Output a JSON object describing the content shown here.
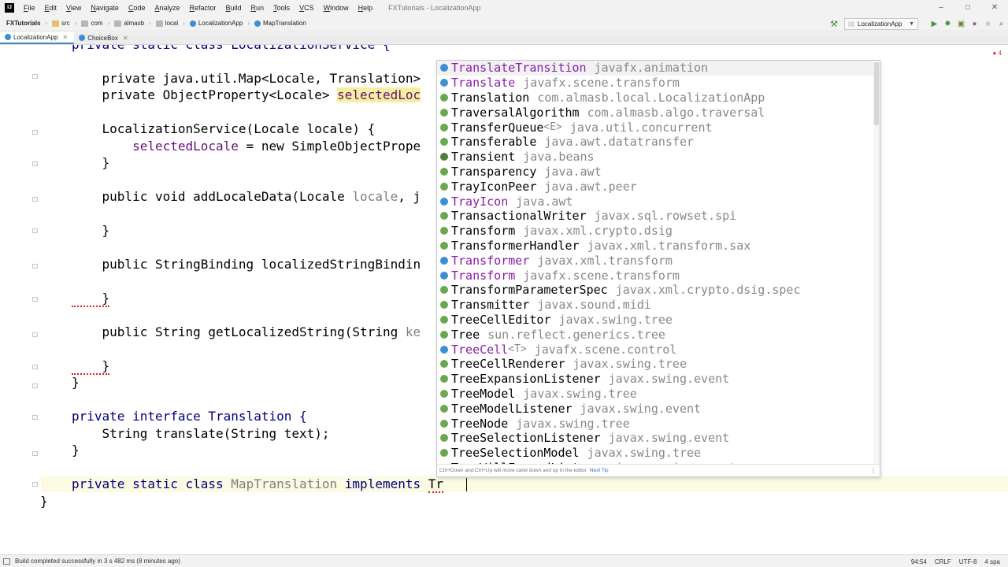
{
  "app": {
    "window_title": "FXTutorials - LocalizationApp",
    "menu": [
      "File",
      "Edit",
      "View",
      "Navigate",
      "Code",
      "Analyze",
      "Refactor",
      "Build",
      "Run",
      "Tools",
      "VCS",
      "Window",
      "Help"
    ]
  },
  "navbar": {
    "crumbs": [
      "FXTutorials",
      "src",
      "com",
      "almasb",
      "local",
      "LocalizationApp",
      "MapTranslation"
    ],
    "run_config": "LocalizationApp"
  },
  "tabs": [
    {
      "label": "LocalizationApp",
      "active": true
    },
    {
      "label": "ChoiceBox",
      "active": false
    }
  ],
  "editor": {
    "error_count": "4",
    "lines": {
      "l1": "private static class LocalizationService {",
      "l2a": "    private java.util.Map<Locale, Translation>",
      "l3a": "    private ObjectProperty<Locale> ",
      "l3b": "selectedLoc",
      "l4": "    LocalizationService(Locale locale) {",
      "l5a": "        ",
      "l5b": "selectedLocale",
      "l5c": " = new SimpleObjectPrope",
      "l6": "    }",
      "l7a": "    public void addLocaleData(Locale ",
      "l7b": "locale",
      "l7c": ", j",
      "l8": "    }",
      "l9": "    public StringBinding localizedStringBindin",
      "l10": "    }",
      "l11a": "    public String getLocalizedString(String ",
      "l11b": "ke",
      "l12": "    }",
      "l13": "}",
      "l14": "private interface Translation {",
      "l15": "    String translate(String text);",
      "l16": "}",
      "l17a": "private static class ",
      "l17b": "MapTranslation",
      "l17c": " implements ",
      "l17d": "Tr",
      "l18": "}"
    }
  },
  "completion": {
    "items": [
      {
        "name": "TranslateTransition",
        "generic": "",
        "pkg": "javafx.animation",
        "kind": "cls",
        "style": "purple"
      },
      {
        "name": "Translate",
        "generic": "",
        "pkg": "javafx.scene.transform",
        "kind": "cls",
        "style": "purple"
      },
      {
        "name": "Translation",
        "generic": "",
        "pkg": "com.almasb.local.LocalizationApp",
        "kind": "iface",
        "style": "plain"
      },
      {
        "name": "TraversalAlgorithm",
        "generic": "",
        "pkg": "com.almasb.algo.traversal",
        "kind": "iface",
        "style": "plain"
      },
      {
        "name": "TransferQueue",
        "generic": "<E>",
        "pkg": "java.util.concurrent",
        "kind": "iface",
        "style": "plain"
      },
      {
        "name": "Transferable",
        "generic": "",
        "pkg": "java.awt.datatransfer",
        "kind": "iface",
        "style": "plain"
      },
      {
        "name": "Transient",
        "generic": "",
        "pkg": "java.beans",
        "kind": "enm",
        "style": "plain"
      },
      {
        "name": "Transparency",
        "generic": "",
        "pkg": "java.awt",
        "kind": "iface",
        "style": "plain"
      },
      {
        "name": "TrayIconPeer",
        "generic": "",
        "pkg": "java.awt.peer",
        "kind": "iface",
        "style": "plain"
      },
      {
        "name": "TrayIcon",
        "generic": "",
        "pkg": "java.awt",
        "kind": "cls",
        "style": "purple"
      },
      {
        "name": "TransactionalWriter",
        "generic": "",
        "pkg": "javax.sql.rowset.spi",
        "kind": "iface",
        "style": "plain"
      },
      {
        "name": "Transform",
        "generic": "",
        "pkg": "javax.xml.crypto.dsig",
        "kind": "iface",
        "style": "plain"
      },
      {
        "name": "TransformerHandler",
        "generic": "",
        "pkg": "javax.xml.transform.sax",
        "kind": "iface",
        "style": "plain"
      },
      {
        "name": "Transformer",
        "generic": "",
        "pkg": "javax.xml.transform",
        "kind": "cls",
        "style": "purple"
      },
      {
        "name": "Transform",
        "generic": "",
        "pkg": "javafx.scene.transform",
        "kind": "cls",
        "style": "purple"
      },
      {
        "name": "TransformParameterSpec",
        "generic": "",
        "pkg": "javax.xml.crypto.dsig.spec",
        "kind": "iface",
        "style": "plain"
      },
      {
        "name": "Transmitter",
        "generic": "",
        "pkg": "javax.sound.midi",
        "kind": "iface",
        "style": "plain"
      },
      {
        "name": "TreeCellEditor",
        "generic": "",
        "pkg": "javax.swing.tree",
        "kind": "iface",
        "style": "plain"
      },
      {
        "name": "Tree",
        "generic": "",
        "pkg": "sun.reflect.generics.tree",
        "kind": "iface",
        "style": "plain"
      },
      {
        "name": "TreeCell",
        "generic": "<T>",
        "pkg": "javafx.scene.control",
        "kind": "cls",
        "style": "purple"
      },
      {
        "name": "TreeCellRenderer",
        "generic": "",
        "pkg": "javax.swing.tree",
        "kind": "iface",
        "style": "plain"
      },
      {
        "name": "TreeExpansionListener",
        "generic": "",
        "pkg": "javax.swing.event",
        "kind": "iface",
        "style": "plain"
      },
      {
        "name": "TreeModel",
        "generic": "",
        "pkg": "javax.swing.tree",
        "kind": "iface",
        "style": "plain"
      },
      {
        "name": "TreeModelListener",
        "generic": "",
        "pkg": "javax.swing.event",
        "kind": "iface",
        "style": "plain"
      },
      {
        "name": "TreeNode",
        "generic": "",
        "pkg": "javax.swing.tree",
        "kind": "iface",
        "style": "plain"
      },
      {
        "name": "TreeSelectionListener",
        "generic": "",
        "pkg": "javax.swing.event",
        "kind": "iface",
        "style": "plain"
      },
      {
        "name": "TreeSelectionModel",
        "generic": "",
        "pkg": "javax.swing.tree",
        "kind": "iface",
        "style": "plain"
      },
      {
        "name": "TreeWillExpandListener",
        "generic": "",
        "pkg": "javax.swing.event",
        "kind": "iface",
        "style": "plain"
      }
    ],
    "footer": "Ctrl+Down and Ctrl+Up will move caret down and up in the editor",
    "footer_tip": "Next Tip"
  },
  "statusbar": {
    "message": "Build completed successfully in 3 s 482 ms (8 minutes ago)",
    "position": "94:54",
    "line_sep": "CRLF",
    "encoding": "UTF-8",
    "indent": "4 spa"
  }
}
